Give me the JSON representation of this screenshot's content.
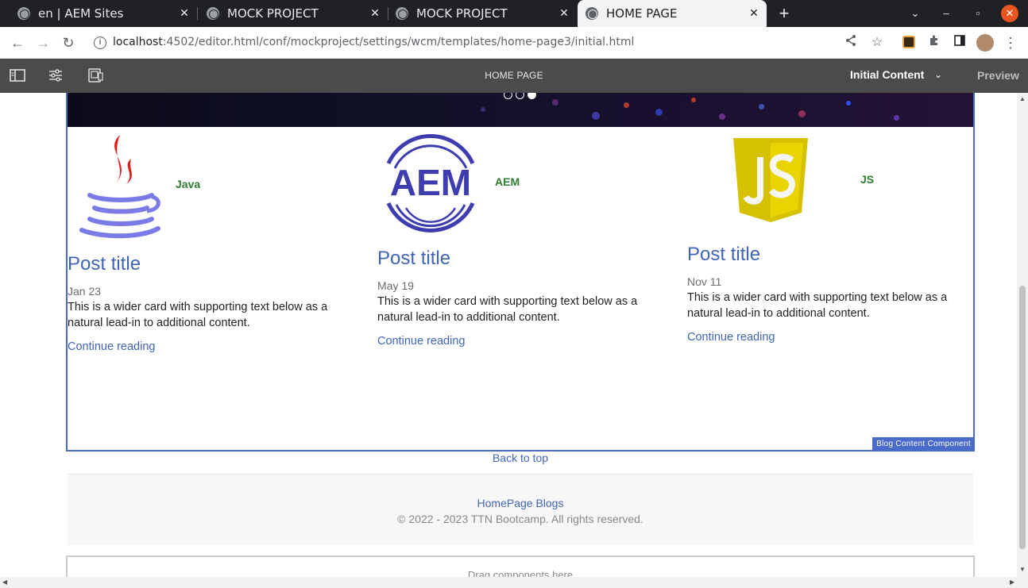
{
  "browser": {
    "tabs": [
      {
        "title": "en | AEM Sites",
        "active": false
      },
      {
        "title": "MOCK PROJECT",
        "active": false
      },
      {
        "title": "MOCK PROJECT",
        "active": false
      },
      {
        "title": "HOME PAGE",
        "active": true
      }
    ],
    "url_host": "localhost",
    "url_rest": ":4502/editor.html/conf/mockproject/settings/wcm/templates/home-page3/initial.html"
  },
  "aem": {
    "page_title": "HOME PAGE",
    "mode": "Initial Content",
    "preview_label": "Preview"
  },
  "carousel": {
    "slide_count": 3,
    "active_index": 2
  },
  "cards": [
    {
      "tag": "Java",
      "title": "Post title",
      "date": "Jan 23",
      "text": "This is a wider card with supporting text below as a natural lead-in to additional content.",
      "link": "Continue reading",
      "logo": "java-logo"
    },
    {
      "tag": "AEM",
      "title": "Post title",
      "date": "May 19",
      "text": "This is a wider card with supporting text below as a natural lead-in to additional content.",
      "link": "Continue reading",
      "logo": "aem-logo"
    },
    {
      "tag": "JS",
      "title": "Post title",
      "date": "Nov 11",
      "text": "This is a wider card with supporting text below as a natural lead-in to additional content.",
      "link": "Continue reading",
      "logo": "js-logo"
    }
  ],
  "component_label": "Blog Content Component",
  "back_to_top": "Back to top",
  "footer": {
    "link": "HomePage Blogs",
    "copyright": "© 2022 - 2023 TTN Bootcamp. All rights reserved."
  },
  "dropzone_text": "Drag components here",
  "colors": {
    "accent": "#4a6bc9",
    "link": "#4065b4",
    "tag": "#2e7d32",
    "aem_bar": "#4b4b4b"
  }
}
